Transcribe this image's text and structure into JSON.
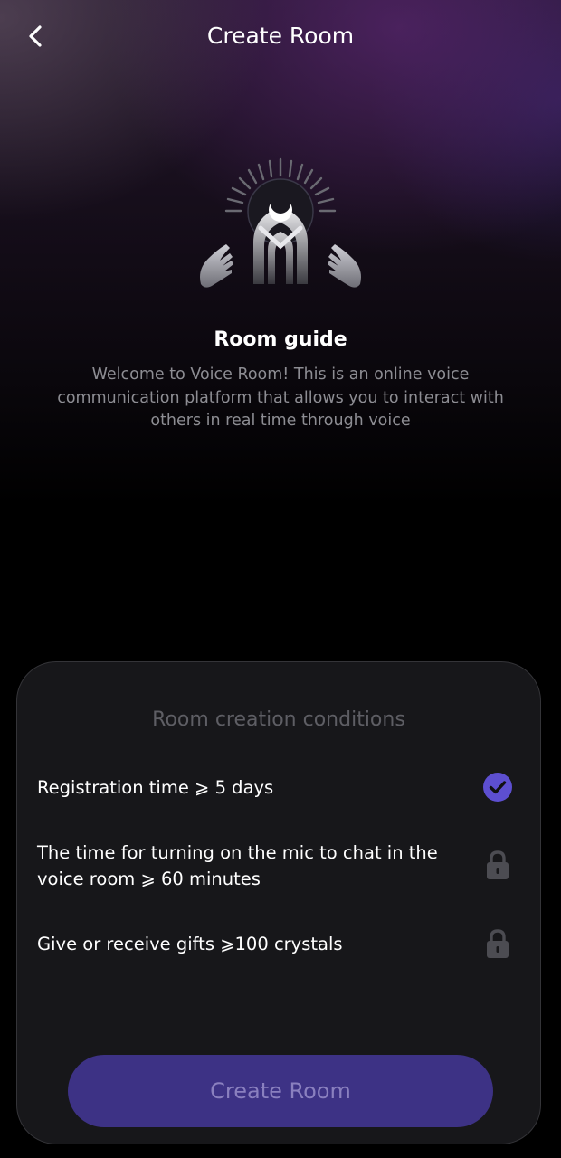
{
  "header": {
    "title": "Create Room",
    "back_icon": "chevron-left-icon"
  },
  "guide": {
    "emblem_icon": "crescent-arch-hands-emblem",
    "title": "Room guide",
    "description": "Welcome to Voice Room! This is an online voice communication platform that allows you to interact with others in real time through voice"
  },
  "conditions": {
    "title": "Room creation conditions",
    "items": [
      {
        "label": "Registration time ⩾ 5 days",
        "status": "completed",
        "icon": "check-circle-icon"
      },
      {
        "label": "The time for turning on the mic to chat in the voice room ⩾ 60 minutes",
        "status": "locked",
        "icon": "lock-icon"
      },
      {
        "label": "Give or receive gifts ⩾100 crystals",
        "status": "locked",
        "icon": "lock-icon"
      }
    ]
  },
  "action": {
    "create_label": "Create Room"
  },
  "colors": {
    "accent": "#5d4fd0",
    "button_bg": "#3d3285",
    "button_text": "#8a80bf",
    "card_bg": "#17171a",
    "lock": "#4c4c52"
  }
}
